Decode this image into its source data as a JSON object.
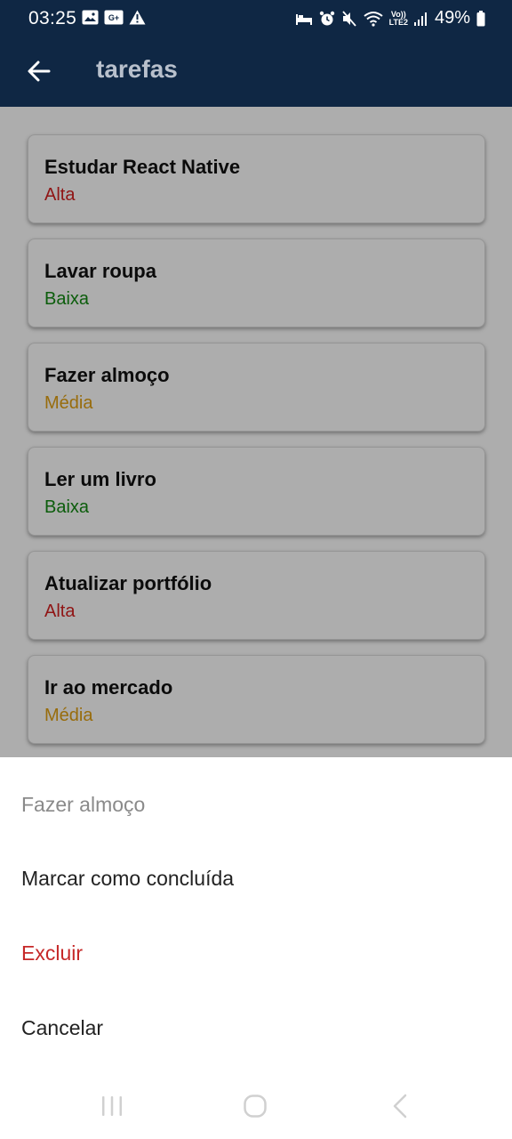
{
  "status_bar": {
    "time": "03:25",
    "battery": "49%",
    "left_icons": [
      "image-icon",
      "data-saver-icon",
      "warning-icon"
    ],
    "right_icons": [
      "sleep-icon",
      "alarm-icon",
      "mute-icon",
      "wifi-icon",
      "lte-icon",
      "signal-icon",
      "battery-icon"
    ],
    "lte_label_top": "Vo))",
    "lte_label_bottom": "LTE2"
  },
  "header": {
    "title": "tarefas",
    "back_icon": "arrow-left-icon"
  },
  "tasks": [
    {
      "title": "Estudar React Native",
      "priority": "Alta"
    },
    {
      "title": "Lavar roupa",
      "priority": "Baixa"
    },
    {
      "title": "Fazer almoço",
      "priority": "Média"
    },
    {
      "title": "Ler um livro",
      "priority": "Baixa"
    },
    {
      "title": "Atualizar portfólio",
      "priority": "Alta"
    },
    {
      "title": "Ir ao mercado",
      "priority": "Média"
    }
  ],
  "priority_colors": {
    "Alta": "#d42020",
    "Baixa": "#138a13",
    "Média": "#e0a013"
  },
  "action_sheet": {
    "title": "Fazer almoço",
    "options": [
      "Marcar como concluída",
      "Excluir",
      "Cancelar"
    ],
    "destructive_color": "#c62828"
  },
  "nav_bar": {
    "icons": [
      "recents-icon",
      "home-icon",
      "back-icon"
    ]
  },
  "colors": {
    "header_bg": "#0f2744",
    "header_title": "#b8c0cc"
  }
}
